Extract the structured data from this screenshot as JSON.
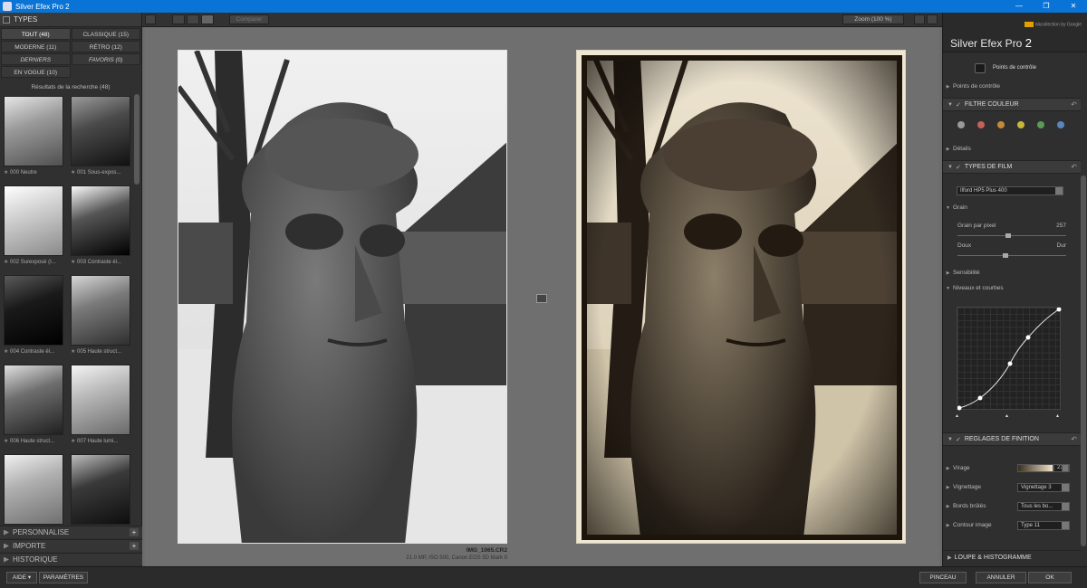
{
  "window": {
    "title": "Silver Efex Pro 2",
    "controls": [
      "—",
      "❐",
      "✕"
    ]
  },
  "left_panel": {
    "types_label": "TYPES",
    "filters": [
      {
        "label": "TOUT (48)"
      },
      {
        "label": "CLASSIQUE (15)"
      },
      {
        "label": "MODERNE (11)"
      },
      {
        "label": "RÉTRO (12)"
      },
      {
        "label": "DERNIERS"
      },
      {
        "label": "FAVORIS (0)"
      },
      {
        "label": "EN VOGUE (10)"
      }
    ],
    "results_label": "Résultats de la recherche (48)",
    "presets": [
      {
        "label": "000 Neutre"
      },
      {
        "label": "001 Sous-expos..."
      },
      {
        "label": "002 Surexposé (I..."
      },
      {
        "label": "003 Contraste él..."
      },
      {
        "label": "004 Contraste él..."
      },
      {
        "label": "005 Haute struct..."
      },
      {
        "label": "006 Haute struct..."
      },
      {
        "label": "007 Haute lumi..."
      }
    ],
    "sections": [
      {
        "label": "PERSONNALISE"
      },
      {
        "label": "IMPORTE"
      },
      {
        "label": "HISTORIQUE"
      }
    ],
    "plus": "+"
  },
  "toolbar": {
    "compare_label": "Comparer",
    "zoom_label": "Zoom (100 %)"
  },
  "photo_info": {
    "filename": "IMG_1065.CR2",
    "details": "21.0 MP, ISO 500, Canon EOS 5D Mark II"
  },
  "right_panel": {
    "brand": {
      "name": "Silver Efex Pro",
      "version": "2",
      "vendor": "nikcollection by Google"
    },
    "control_points_button": "Points de contrôle",
    "control_points_row": "Points de contrôle",
    "color_filter": {
      "title": "FILTRE COULEUR",
      "details_row": "Détails",
      "dots": [
        "#9a9a9a",
        "#c8605a",
        "#c7883a",
        "#c7b73a",
        "#5a9a55",
        "#5a86c0"
      ]
    },
    "film_types": {
      "title": "TYPES DE FILM",
      "film": "Ilford HP5 Plus 400",
      "grain_label": "Grain",
      "grain_per_pixel_label": "Grain par pixel",
      "grain_per_pixel_value": "257",
      "grain_per_pixel_level": 0.47,
      "soft_label": "Doux",
      "hard_label": "Dur",
      "soft_hard_level": 0.44,
      "sensitivity_label": "Sensibilité",
      "levels_label": "Niveaux et courbes"
    },
    "finishing": {
      "title": "REGLAGES DE FINITION",
      "toning_label": "Virage",
      "toning_value": "21",
      "vignette_label": "Vignettage",
      "vignette_value": "Vignettage 3",
      "burned_edges_label": "Bords brûlés",
      "burned_edges_value": "Tous les bo...",
      "image_border_label": "Contour image",
      "image_border_value": "Type 11"
    },
    "loupe_label": "LOUPE & HISTOGRAMME"
  },
  "bottom_bar": {
    "help": "AIDE ▾",
    "settings": "PARAMÈTRES",
    "brush": "PINCEAU",
    "cancel": "ANNULER",
    "ok": "OK"
  }
}
